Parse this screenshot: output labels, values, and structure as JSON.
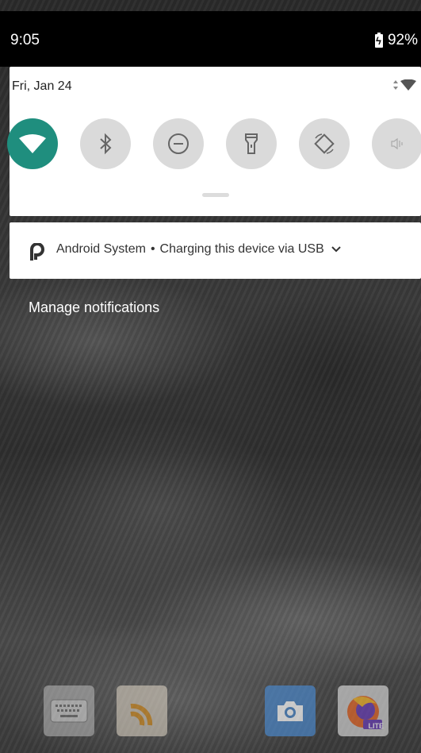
{
  "status_bar": {
    "time": "9:05",
    "battery_percent": "92%",
    "battery_icon": "battery-charging-icon"
  },
  "quick_settings": {
    "date": "Fri, Jan 24",
    "tiles": [
      {
        "name": "wifi",
        "icon": "wifi-icon",
        "active": true
      },
      {
        "name": "bluetooth",
        "icon": "bluetooth-icon",
        "active": false
      },
      {
        "name": "do-not-disturb",
        "icon": "do-not-disturb-icon",
        "active": false
      },
      {
        "name": "flashlight",
        "icon": "flashlight-icon",
        "active": false
      },
      {
        "name": "auto-rotate",
        "icon": "auto-rotate-icon",
        "active": false
      },
      {
        "name": "sound",
        "icon": "vibrate-icon",
        "active": false
      }
    ],
    "active_color": "#1f8e7e",
    "inactive_color": "#dadada"
  },
  "notification": {
    "app_name": "Android System",
    "separator": "•",
    "message": "Charging this device via USB"
  },
  "manage_notifications": "Manage notifications",
  "dock": {
    "apps": [
      {
        "name": "keyboard-app",
        "icon": "keyboard-icon"
      },
      {
        "name": "rss-reader-app",
        "icon": "rss-icon"
      },
      {
        "name": "camera-app",
        "icon": "camera-icon"
      },
      {
        "name": "firefox-lite-app",
        "icon": "firefox-lite-icon",
        "badge": "LITE"
      }
    ]
  }
}
